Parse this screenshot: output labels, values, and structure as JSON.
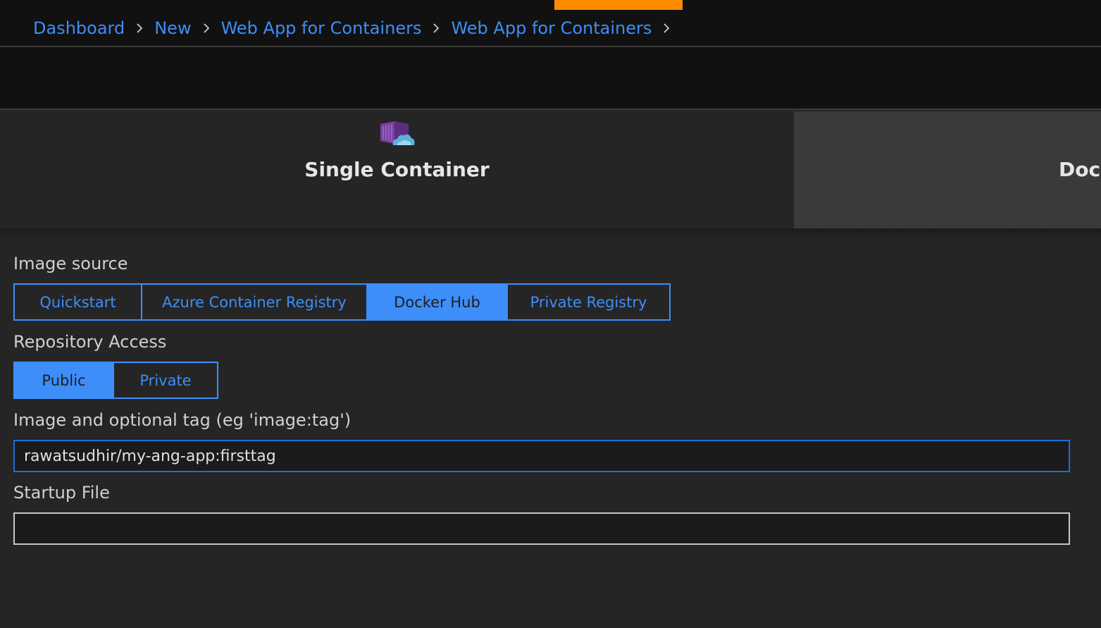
{
  "breadcrumb": {
    "items": [
      "Dashboard",
      "New",
      "Web App for Containers",
      "Web App for Containers"
    ]
  },
  "tabs": {
    "single": {
      "label": "Single Container",
      "icon": "container-cloud-icon"
    },
    "docker": {
      "label": "Docker Compose"
    }
  },
  "image_source": {
    "label": "Image source",
    "options": [
      "Quickstart",
      "Azure Container Registry",
      "Docker Hub",
      "Private Registry"
    ],
    "selected": "Docker Hub"
  },
  "repository_access": {
    "label": "Repository Access",
    "options": [
      "Public",
      "Private"
    ],
    "selected": "Public"
  },
  "image_tag": {
    "label": "Image and optional tag (eg 'image:tag')",
    "value": "rawatsudhir/my-ang-app:firsttag"
  },
  "startup_file": {
    "label": "Startup File",
    "value": ""
  },
  "colors": {
    "accent": "#ff8c00",
    "link": "#3d8ef8",
    "background": "#252526"
  }
}
